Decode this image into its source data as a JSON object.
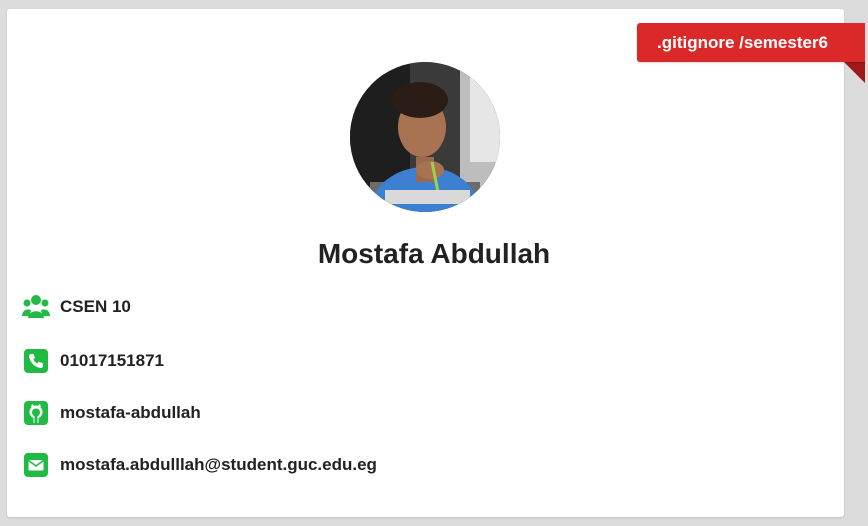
{
  "ribbon": {
    "label": ".gitignore /semester6",
    "color": "#db2828"
  },
  "profile": {
    "name": "Mostafa Abdullah",
    "avatar_alt": "profile photo"
  },
  "accent_color": "#21ba45",
  "details": [
    {
      "icon": "users-icon",
      "text": "CSEN 10"
    },
    {
      "icon": "phone-icon",
      "text": "01017151871"
    },
    {
      "icon": "github-icon",
      "text": "mostafa-abdullah"
    },
    {
      "icon": "mail-icon",
      "text": "mostafa.abdulllah@student.guc.edu.eg"
    }
  ]
}
